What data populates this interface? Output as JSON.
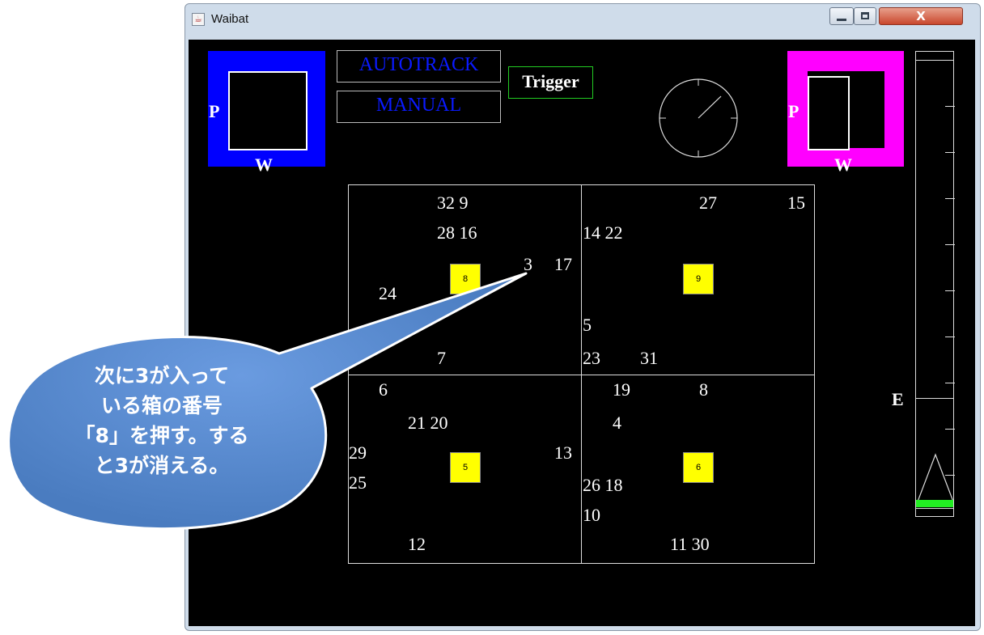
{
  "window": {
    "title": "Waibat",
    "app_icon": "java-cup-icon",
    "close_label": "X"
  },
  "left_pw_indicator": {
    "color": "#0000ff",
    "p_label": "P",
    "w_label": "W"
  },
  "right_pw_indicator": {
    "color": "#ff00ff",
    "p_label": "P",
    "w_label": "W"
  },
  "mode_buttons": {
    "autotrack": "AUTOTRACK",
    "manual": "MANUAL",
    "trigger": "Trigger"
  },
  "quadrants": [
    {
      "box_label": "8",
      "numbers": [
        "32 9",
        "28 16",
        "3",
        "17",
        "24",
        "7"
      ]
    },
    {
      "box_label": "9",
      "numbers": [
        "27",
        "15",
        "14 22",
        "5",
        "23",
        "31"
      ]
    },
    {
      "box_label": "5",
      "numbers": [
        "6",
        "21 20",
        "29",
        "13",
        "25",
        "12"
      ]
    },
    {
      "box_label": "6",
      "numbers": [
        "19",
        "8",
        "4",
        "26 18",
        "10",
        "11 30"
      ]
    }
  ],
  "gauge": {
    "label": "E",
    "level_color": "#22ee22"
  },
  "callout": {
    "lines": [
      "次に3が入って",
      "いる箱の番号",
      "「8」を押す。する",
      "と3が消える。"
    ],
    "fill": "#5b8ed1"
  },
  "colors": {
    "box_yellow": "#ffff00",
    "trigger_border": "#22cc22",
    "mode_text": "#0a1aff"
  }
}
